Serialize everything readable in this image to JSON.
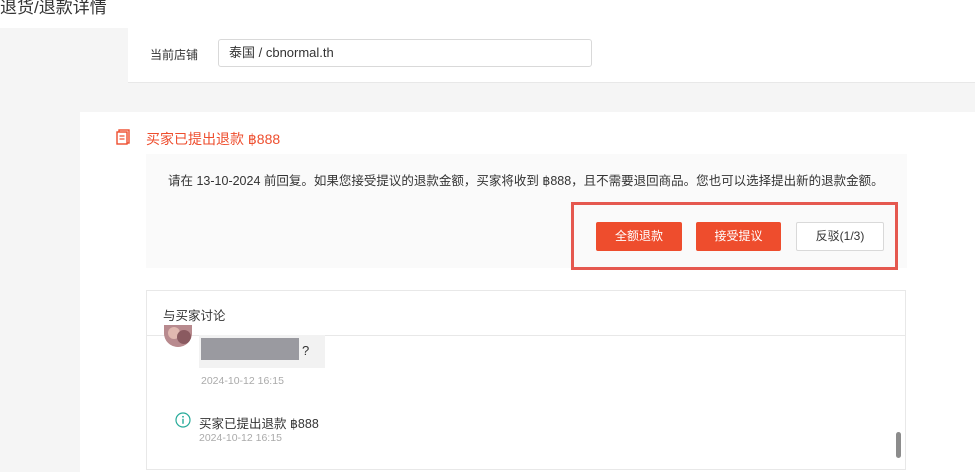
{
  "header": {
    "title": "退货/退款详情"
  },
  "shop": {
    "label": "当前店铺",
    "value": "泰国 / cbnormal.th"
  },
  "status": {
    "icon": "document-icon",
    "title": "买家已提出退款 ฿888"
  },
  "notice": {
    "text": "请在 13-10-2024 前回复。如果您接受提议的退款金额，买家将收到 ฿888，且不需要退回商品。您也可以选择提出新的退款金额。"
  },
  "actions": {
    "full_refund": "全额退款",
    "accept": "接受提议",
    "dispute": "反驳(1/3)"
  },
  "discussion": {
    "title": "与买家讨论",
    "message": {
      "text_suffix": "?",
      "time": "2024-10-12 16:15"
    },
    "system": {
      "icon": "info-icon",
      "text": "买家已提出退款 ฿888",
      "time": "2024-10-12 16:15"
    }
  },
  "colors": {
    "accent": "#ee4d2d",
    "highlight": "#e5584f",
    "info": "#26aa99"
  }
}
